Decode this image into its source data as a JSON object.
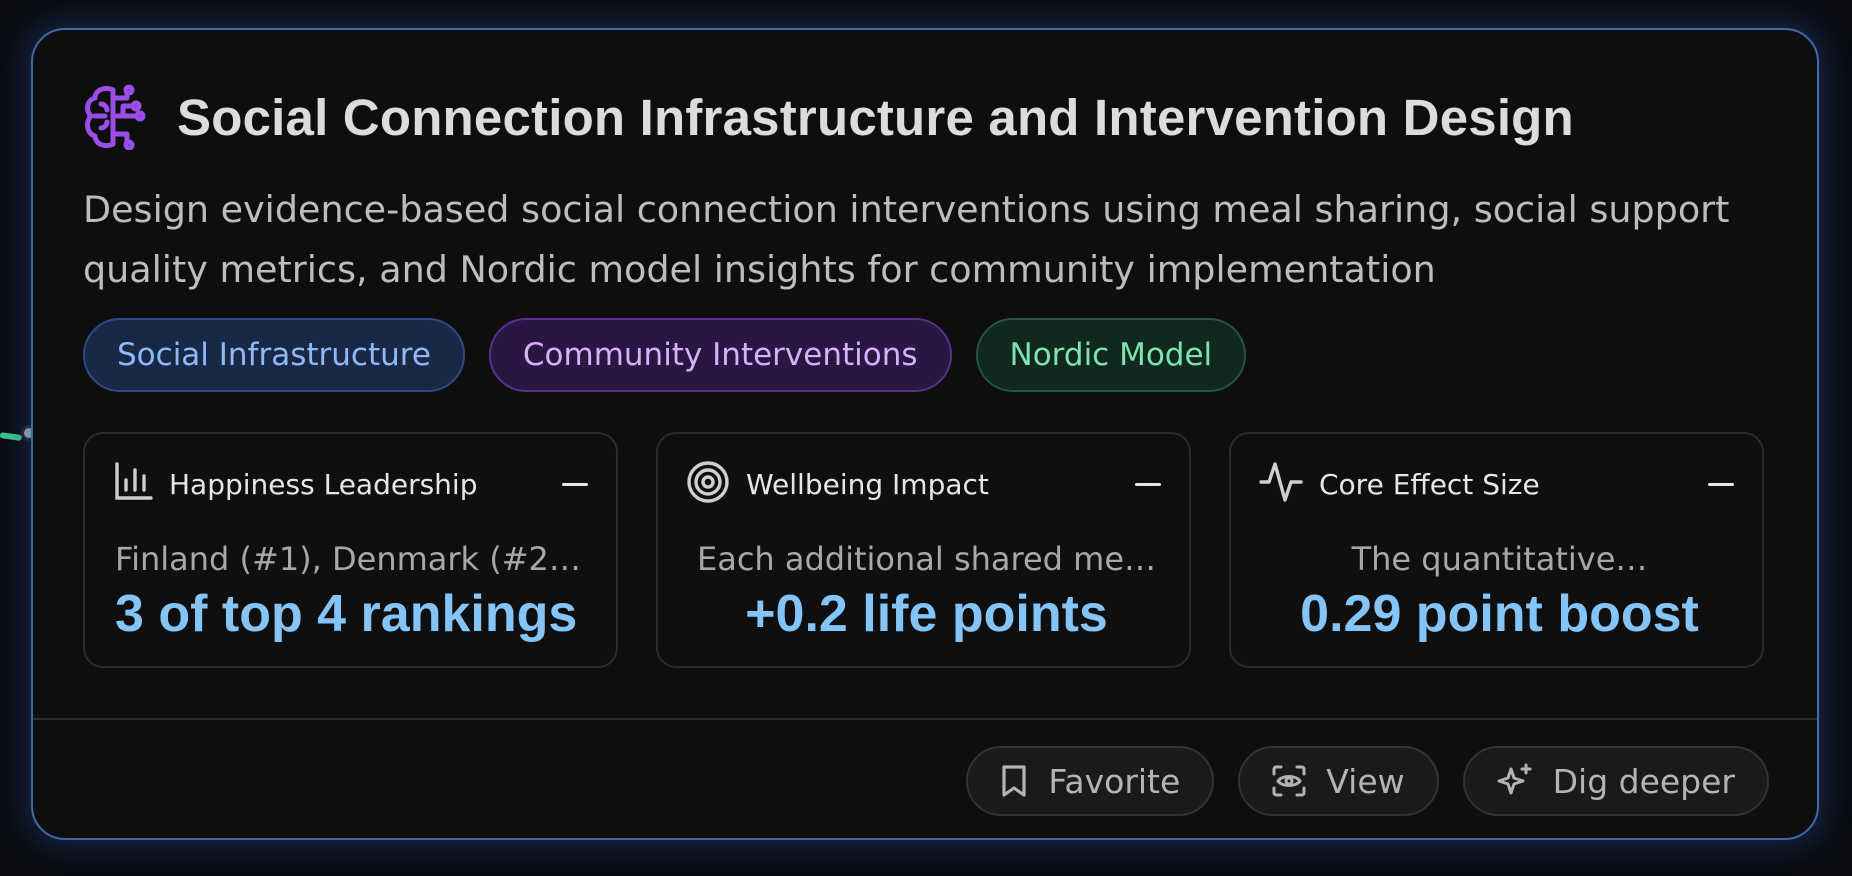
{
  "card": {
    "title": "Social Connection Infrastructure and Intervention Design",
    "description": "Design evidence-based social connection interventions using meal sharing, social support quality metrics, and Nordic model insights for community implementation",
    "icon": "brain-circuit-icon"
  },
  "tags": [
    {
      "label": "Social Infrastructure",
      "color": "#8fbaf5"
    },
    {
      "label": "Community Interventions",
      "color": "#d5b0fb"
    },
    {
      "label": "Nordic Model",
      "color": "#7ee3ae"
    }
  ],
  "metrics": [
    {
      "icon": "bar-chart-icon",
      "label": "Happiness Leadership",
      "subtitle": "Finland (#1), Denmark (#2…",
      "value": "3 of top 4 rankings"
    },
    {
      "icon": "target-icon",
      "label": "Wellbeing Impact",
      "subtitle": "Each additional shared me…",
      "value": "+0.2 life points"
    },
    {
      "icon": "activity-icon",
      "label": "Core Effect Size",
      "subtitle": "The quantitative…",
      "value": "0.29 point boost"
    }
  ],
  "actions": {
    "favorite": "Favorite",
    "view": "View",
    "dig_deeper": "Dig deeper"
  },
  "colors": {
    "accent_value": "#84c4f7",
    "border": "#3f6aa8",
    "brain_icon": "#9b4de8"
  }
}
